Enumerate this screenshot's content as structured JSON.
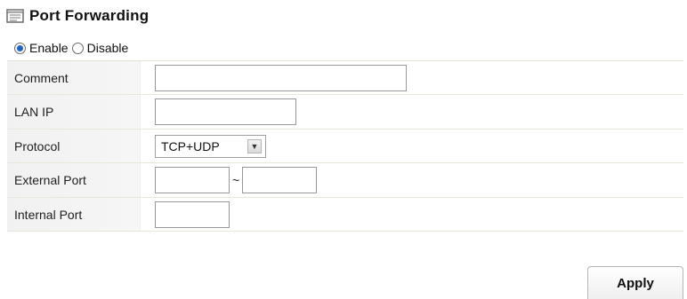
{
  "header": {
    "title": "Port Forwarding",
    "icon": "form-window-icon"
  },
  "mode": {
    "enable_label": "Enable",
    "disable_label": "Disable",
    "selected": "Enable"
  },
  "form": {
    "comment_label": "Comment",
    "comment_value": "",
    "lan_ip_label": "LAN IP",
    "lan_ip_value": "",
    "protocol_label": "Protocol",
    "protocol_value": "TCP+UDP",
    "external_port_label": "External Port",
    "external_port_start": "",
    "external_port_separator": "~",
    "external_port_end": "",
    "internal_port_label": "Internal Port",
    "internal_port_value": ""
  },
  "actions": {
    "apply_label": "Apply"
  },
  "colors": {
    "accent": "#1f62c8",
    "label_background": "#f2f2f2",
    "border": "#979797"
  }
}
